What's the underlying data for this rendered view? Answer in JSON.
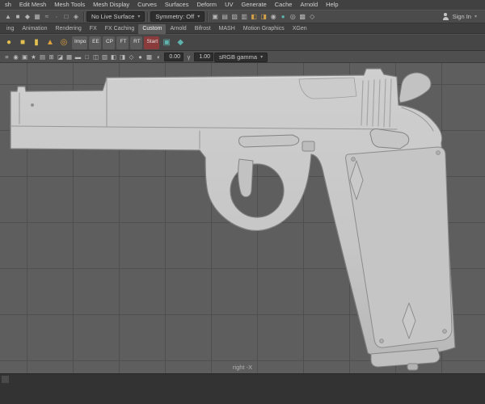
{
  "icons": {
    "caret": "▾"
  },
  "menu_bar": {
    "items": [
      "sh",
      "Edit Mesh",
      "Mesh Tools",
      "Mesh Display",
      "Curves",
      "Surfaces",
      "Deform",
      "UV",
      "Generate",
      "Cache",
      "Arnold",
      "Help"
    ]
  },
  "status_line": {
    "left_icons": [
      {
        "name": "select-hierarchy-icon",
        "glyph": "▲"
      },
      {
        "name": "select-object-icon",
        "glyph": "■"
      },
      {
        "name": "select-component-icon",
        "glyph": "◆"
      },
      {
        "name": "snap-grid-icon",
        "glyph": "▦"
      },
      {
        "name": "snap-curve-icon",
        "glyph": "≈"
      },
      {
        "name": "snap-point-icon",
        "glyph": "∙"
      },
      {
        "name": "snap-viewplane-icon",
        "glyph": "□"
      },
      {
        "name": "make-live-icon",
        "glyph": "◈"
      }
    ],
    "live_surface": "No Live Surface",
    "symmetry": "Symmetry: Off",
    "mid_icons": [
      {
        "name": "history-toggle-icon",
        "glyph": "▣"
      },
      {
        "name": "construction-history-icon",
        "glyph": "▤"
      },
      {
        "name": "paint-effects-icon",
        "glyph": "▨"
      },
      {
        "name": "render-view-icon",
        "glyph": "▥"
      },
      {
        "name": "render-frame-icon",
        "glyph": "◧",
        "color": "#cf9f4a"
      },
      {
        "name": "ipr-render-icon",
        "glyph": "◨",
        "color": "#cf9f4a"
      },
      {
        "name": "render-settings-icon",
        "glyph": "◉"
      },
      {
        "name": "hypershade-icon",
        "glyph": "●",
        "color": "#5fb3ae"
      },
      {
        "name": "node-editor-icon",
        "glyph": "◎"
      },
      {
        "name": "toon-outline-icon",
        "glyph": "▩"
      },
      {
        "name": "launch-application-icon",
        "glyph": "◇"
      }
    ],
    "sign_in": "Sign In"
  },
  "shelf_tabs": {
    "tabs": [
      {
        "name": "tab-modeling",
        "label": "ing"
      },
      {
        "name": "tab-animation",
        "label": "Animation"
      },
      {
        "name": "tab-rendering",
        "label": "Rendering"
      },
      {
        "name": "tab-fx",
        "label": "FX"
      },
      {
        "name": "tab-fx-caching",
        "label": "FX Caching"
      },
      {
        "name": "tab-custom",
        "label": "Custom",
        "active": true
      },
      {
        "name": "tab-arnold",
        "label": "Arnold"
      },
      {
        "name": "tab-bifrost",
        "label": "Bifrost"
      },
      {
        "name": "tab-mash",
        "label": "MASH"
      },
      {
        "name": "tab-motion-graphics",
        "label": "Motion Graphics"
      },
      {
        "name": "tab-xgen",
        "label": "XGen"
      }
    ]
  },
  "shelf": {
    "items": [
      {
        "name": "poly-sphere-icon",
        "glyph": "●",
        "color": "#e3c04f"
      },
      {
        "name": "poly-cube-icon",
        "glyph": "■",
        "color": "#e3c04f"
      },
      {
        "name": "poly-cylinder-icon",
        "glyph": "▮",
        "color": "#e3c04f"
      },
      {
        "name": "poly-cone-icon",
        "glyph": "▲",
        "color": "#dfa23c"
      },
      {
        "name": "poly-torus-icon",
        "glyph": "◎",
        "color": "#dfa23c"
      },
      {
        "name": "shelf-impo-button",
        "label": "Impo",
        "bg": "#5b5b5b"
      },
      {
        "name": "shelf-ee-button",
        "label": "EE",
        "bg": "#5b5b5b"
      },
      {
        "name": "shelf-cp-button",
        "label": "CP",
        "bg": "#5b5b5b"
      },
      {
        "name": "shelf-ft-button",
        "label": "FT",
        "bg": "#5b5b5b"
      },
      {
        "name": "shelf-rt-button",
        "label": "RT",
        "bg": "#5b5b5b"
      },
      {
        "name": "shelf-start-button",
        "label": "Start",
        "bg": "#8a3b3b"
      },
      {
        "name": "shelf-script-icon",
        "glyph": "▣",
        "color": "#5fb3ae"
      },
      {
        "name": "shelf-tool-icon",
        "glyph": "◆",
        "color": "#5fb3ae"
      }
    ]
  },
  "viewport_toolbar": {
    "icons": [
      {
        "name": "panel-menu-icon",
        "glyph": "≡"
      },
      {
        "name": "lock-camera-icon",
        "glyph": "◉"
      },
      {
        "name": "camera-attributes-icon",
        "glyph": "▣"
      },
      {
        "name": "bookmarks-icon",
        "glyph": "★"
      },
      {
        "name": "image-plane-icon",
        "glyph": "▤"
      },
      {
        "name": "two-d-pan-zoom-icon",
        "glyph": "⊞"
      },
      {
        "name": "grease-pencil-icon",
        "glyph": "◪"
      },
      {
        "name": "grid-toggle-icon",
        "glyph": "▦"
      },
      {
        "name": "film-gate-icon",
        "glyph": "▬"
      },
      {
        "name": "resolution-gate-icon",
        "glyph": "□"
      },
      {
        "name": "gate-mask-icon",
        "glyph": "◫"
      },
      {
        "name": "field-chart-icon",
        "glyph": "▥"
      },
      {
        "name": "safe-action-icon",
        "glyph": "◧"
      },
      {
        "name": "safe-title-icon",
        "glyph": "◨"
      },
      {
        "name": "wireframe-icon",
        "glyph": "◇"
      },
      {
        "name": "shaded-mode-icon",
        "glyph": "●"
      },
      {
        "name": "textured-mode-icon",
        "glyph": "▩"
      }
    ],
    "exposure_icon": "◐",
    "exposure": "0.00",
    "gamma_icon": "γ",
    "gamma": "1.00",
    "color_space": "sRGB gamma"
  },
  "viewport": {
    "camera_label": "right -X",
    "bg_color": "#5e5e5e",
    "grid_color": "#4f4f4f",
    "model_color": "#c8c8c8",
    "model": "m1911-pistol"
  }
}
